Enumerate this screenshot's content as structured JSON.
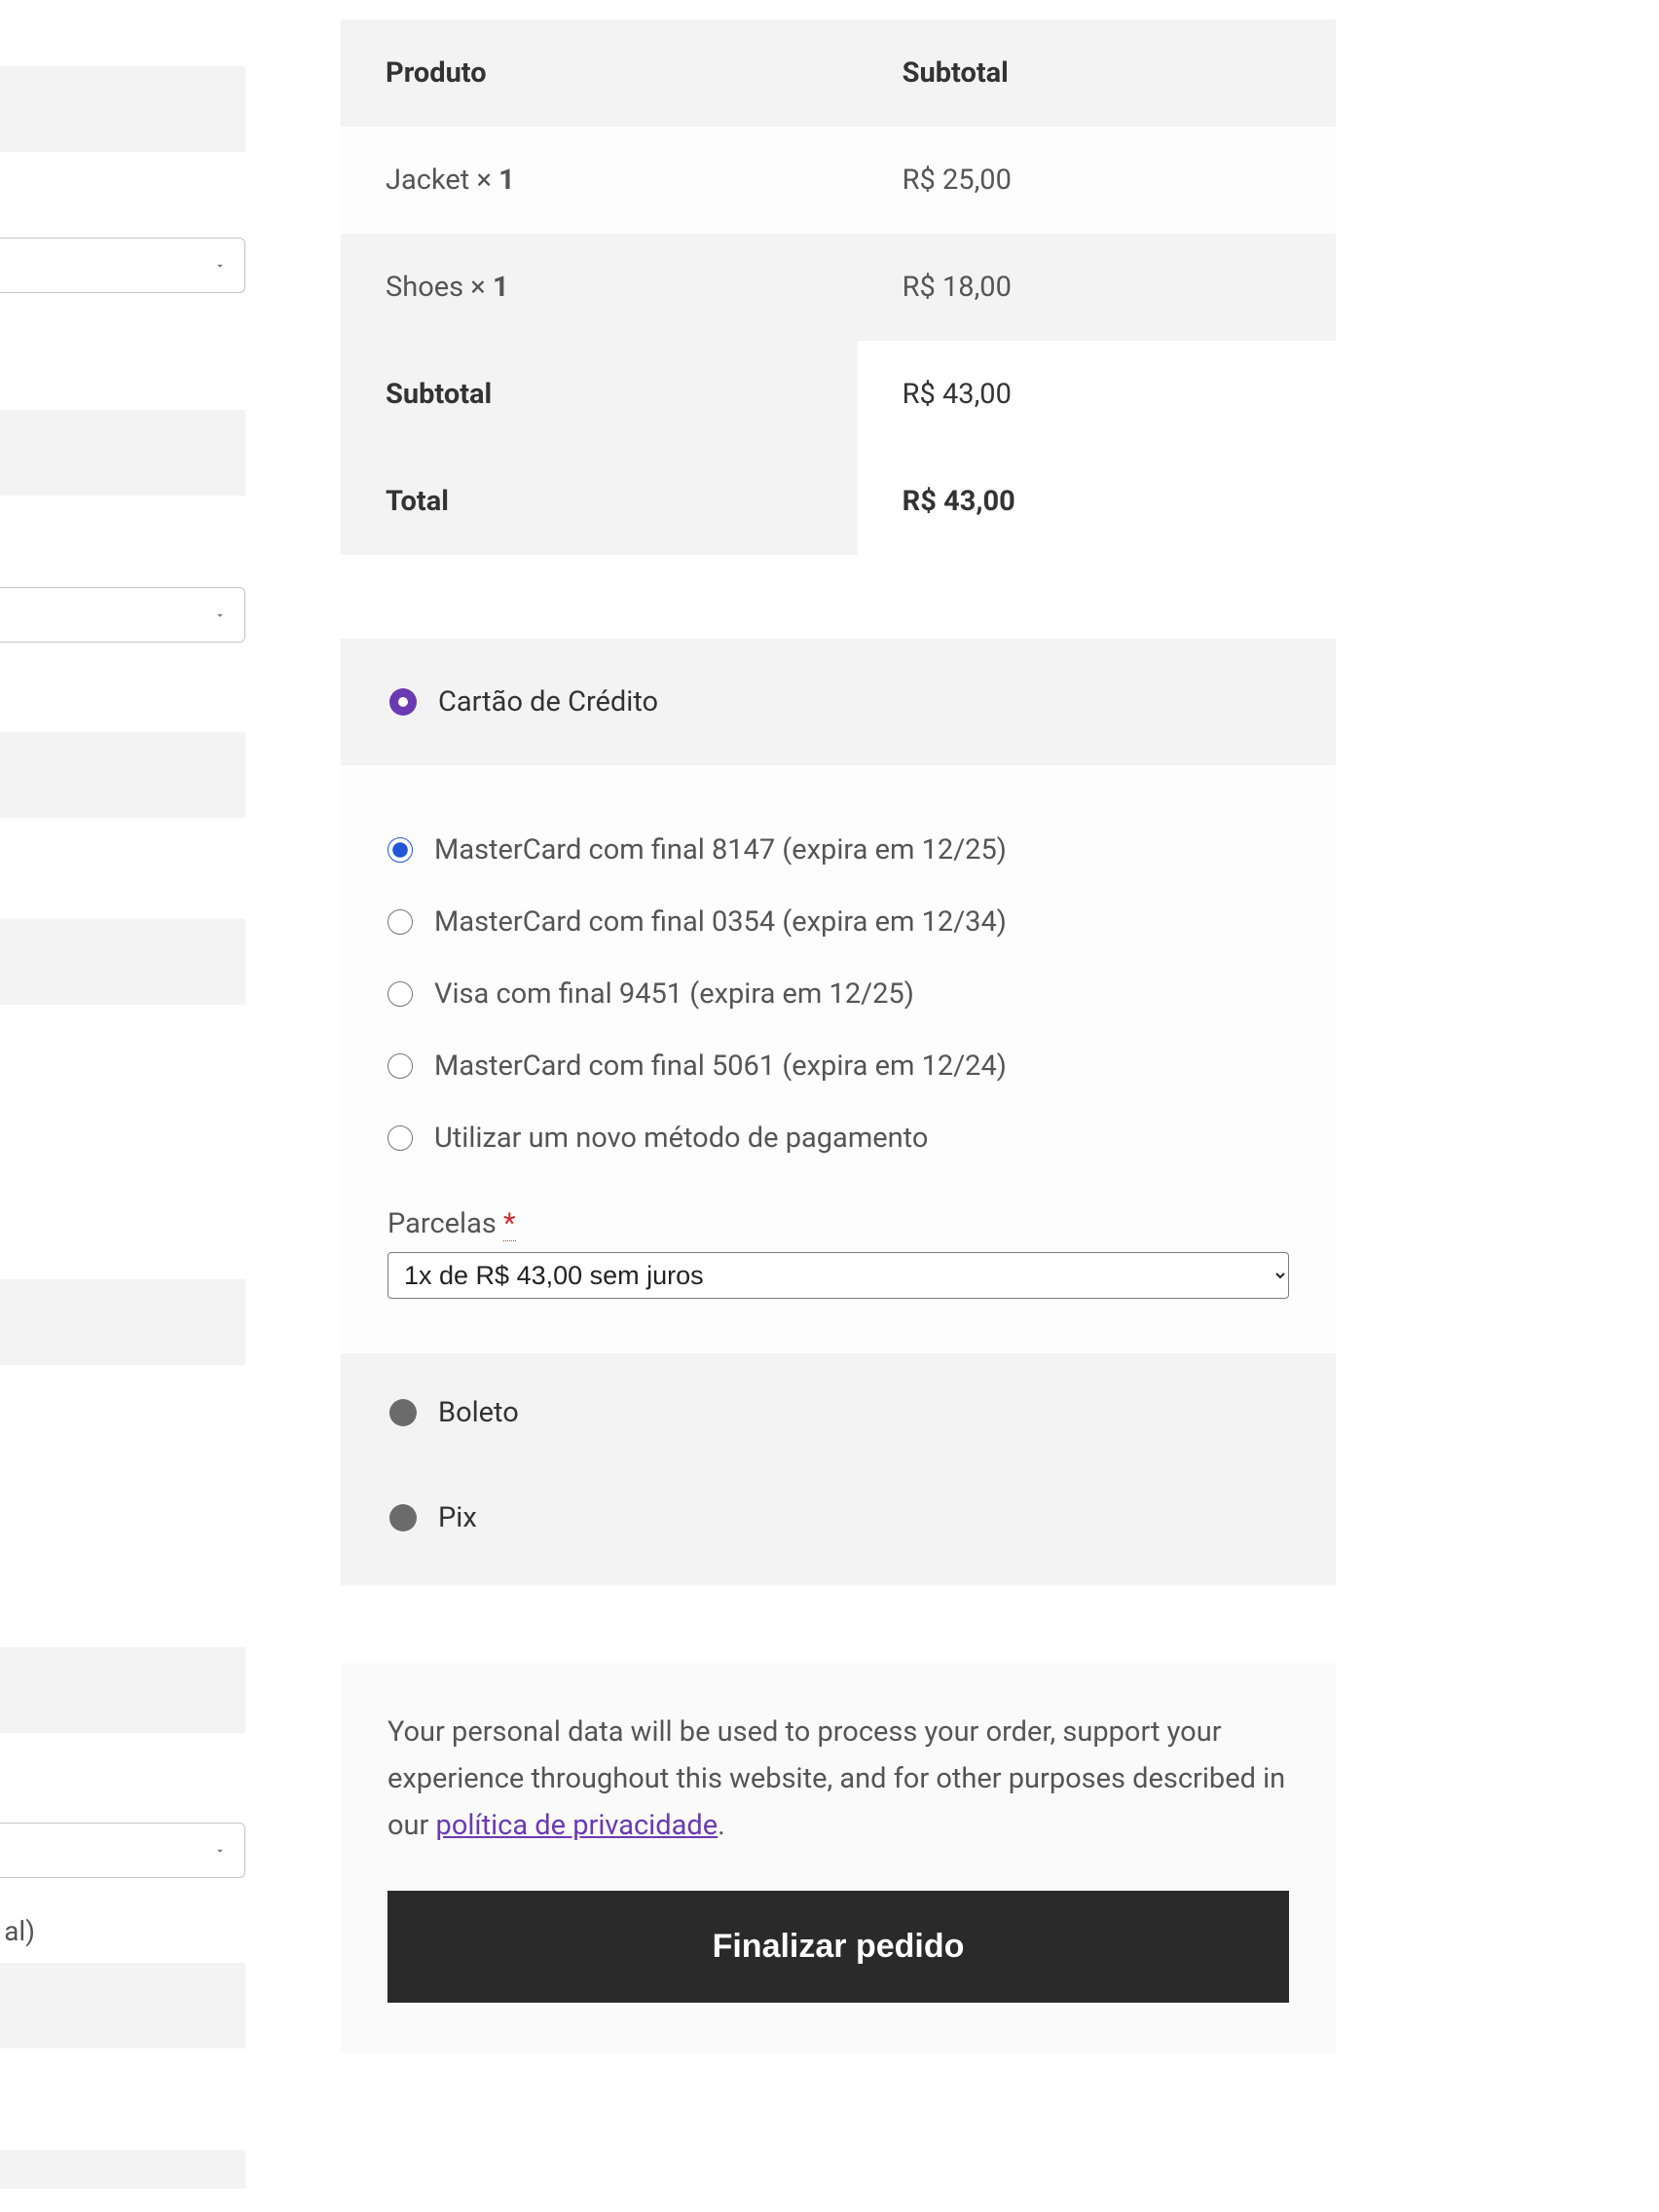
{
  "left": {
    "partial_text": "al)"
  },
  "order_table": {
    "header_product": "Produto",
    "header_subtotal": "Subtotal",
    "rows": [
      {
        "name": "Jacket",
        "qty_prefix": "× ",
        "qty": "1",
        "price": "R$ 25,00"
      },
      {
        "name": "Shoes",
        "qty_prefix": "× ",
        "qty": "1",
        "price": "R$ 18,00"
      }
    ],
    "subtotal_label": "Subtotal",
    "subtotal_value": "R$ 43,00",
    "total_label": "Total",
    "total_value": "R$ 43,00"
  },
  "payment": {
    "credit_card_label": "Cartão de Crédito",
    "cards": [
      "MasterCard com final 8147 (expira em 12/25)",
      "MasterCard com final 0354 (expira em 12/34)",
      "Visa com final 9451 (expira em 12/25)",
      "MasterCard com final 5061 (expira em 12/24)",
      "Utilizar um novo método de pagamento"
    ],
    "parcelas_label": "Parcelas ",
    "parcelas_required": "*",
    "parcelas_value": "1x de R$ 43,00 sem juros",
    "boleto_label": "Boleto",
    "pix_label": "Pix"
  },
  "privacy": {
    "text_before": "Your personal data will be used to process your order, support your experience throughout this website, and for other purposes described in our ",
    "link_text": "política de privacidade",
    "text_after": "."
  },
  "place_order_label": "Finalizar pedido"
}
